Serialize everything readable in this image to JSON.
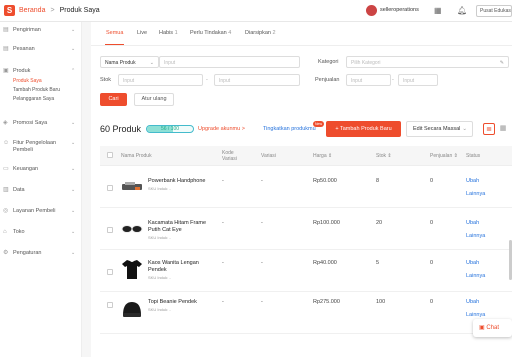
{
  "topbar": {
    "logo": "S",
    "home": "Beranda",
    "separator": ">",
    "page": "Produk Saya",
    "shop": "selleroperations",
    "icons": [
      "grid-icon",
      "bell-icon"
    ],
    "edu_placeholder": "Pusat Edukasi P"
  },
  "sidebar": {
    "sections": [
      {
        "label": "Pengiriman",
        "icon": "truck-icon",
        "chevron": "⌄"
      },
      {
        "label": "Pesanan",
        "icon": "clipboard-icon",
        "chevron": "⌄"
      },
      {
        "label": "Produk",
        "icon": "bag-icon",
        "chevron": "⌃",
        "items": [
          "Produk Saya",
          "Tambah Produk Baru",
          "Pelanggaran Saya"
        ],
        "active": "Produk Saya"
      },
      {
        "label": "Promosi Saya",
        "icon": "tag-icon",
        "chevron": "⌄"
      },
      {
        "label": "Fitur Pengelolaan Pembeli",
        "icon": "users-icon",
        "chevron": "⌄"
      },
      {
        "label": "Keuangan",
        "icon": "wallet-icon",
        "chevron": "⌄"
      },
      {
        "label": "Data",
        "icon": "chart-icon",
        "chevron": "⌄"
      },
      {
        "label": "Layanan Pembeli",
        "icon": "headset-icon",
        "chevron": "⌄"
      },
      {
        "label": "Toko",
        "icon": "store-icon",
        "chevron": "⌄"
      },
      {
        "label": "Pengaturan",
        "icon": "gear-icon",
        "chevron": "⌄"
      }
    ]
  },
  "tabs": [
    {
      "label": "Semua",
      "active": true
    },
    {
      "label": "Live"
    },
    {
      "label": "Habis",
      "count": "1"
    },
    {
      "label": "Perlu Tindakan",
      "count": "4"
    },
    {
      "label": "Diarsipkan",
      "count": "2"
    }
  ],
  "filters": {
    "name_select": "Nama Produk",
    "name_placeholder": "Input",
    "category_label": "Kategori",
    "category_placeholder": "Pilih Kategori",
    "stock_label": "Stok",
    "stock_min_placeholder": "Input",
    "stock_max_placeholder": "Input",
    "range_sep": "-",
    "sales_label": "Penjualan",
    "sales_min_placeholder": "Input",
    "sales_max_placeholder": "Input",
    "search_button": "Cari",
    "reset_button": "Atur ulang"
  },
  "summary": {
    "count": "60 Produk",
    "quota": "56 / 100",
    "quota_fraction": 0.56,
    "upgrade": "Upgrade akunmu >",
    "improve": "Tingkatkan produkmu",
    "badge": "New",
    "add_button": "+ Tambah Produk Baru",
    "mass_button": "Edit Secara Massal",
    "mass_chevron": "⌄",
    "list_view_icon": "≣",
    "grid_view_icon": "▦"
  },
  "table": {
    "headers": [
      "Nama Produk",
      "Kode Variasi",
      "Variasi",
      "Harga ⇕",
      "Stok ⇕",
      "Penjualan ⇕",
      "Status"
    ],
    "rows": [
      {
        "name": "Powerbank Handphone",
        "sku": "SKU Induk: -",
        "code": "-",
        "variant": "-",
        "price": "Rp50.000",
        "stock": "8",
        "sales": "0",
        "action1": "Ubah",
        "action2": "Lainnya",
        "thumb": "powerbank"
      },
      {
        "name": "Kacamata Hitam Frame Putih Cat Eye",
        "sku": "SKU Induk: -",
        "code": "-",
        "variant": "-",
        "price": "Rp100.000",
        "stock": "20",
        "sales": "0",
        "action1": "Ubah",
        "action2": "Lainnya",
        "thumb": "glasses"
      },
      {
        "name": "Kaos Wanita Lengan Pendek",
        "sku": "SKU Induk: -",
        "code": "-",
        "variant": "-",
        "price": "Rp40.000",
        "stock": "5",
        "sales": "0",
        "action1": "Ubah",
        "action2": "Lainnya",
        "thumb": "tshirt"
      },
      {
        "name": "Topi Beanie Pendek",
        "sku": "SKU Induk: -",
        "code": "-",
        "variant": "-",
        "price": "Rp275.000",
        "stock": "100",
        "sales": "0",
        "action1": "Ubah",
        "action2": "Lainnya",
        "thumb": "beanie"
      }
    ]
  },
  "chat": {
    "label": "Chat"
  },
  "colors": {
    "accent": "#ee4d2d",
    "link": "#2673dd",
    "teal": "#22aa88"
  }
}
